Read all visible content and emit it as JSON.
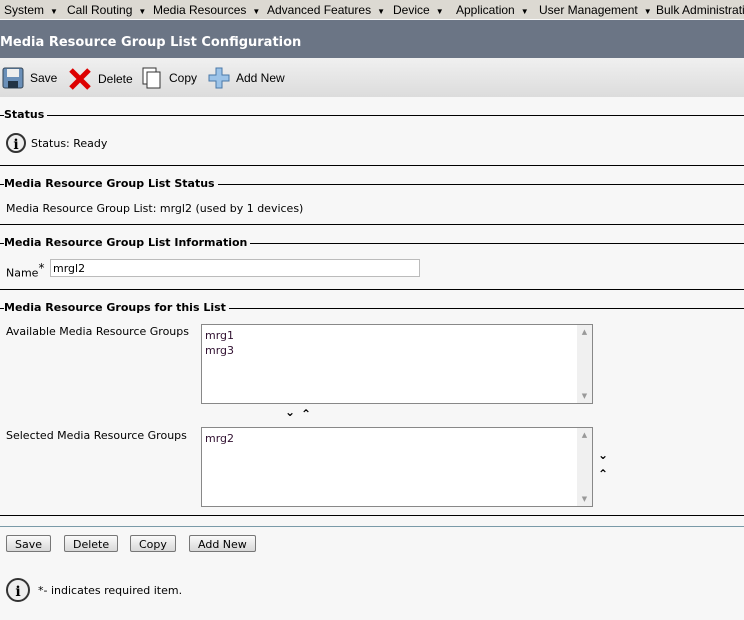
{
  "menu": [
    "System",
    "Call Routing",
    "Media Resources",
    "Advanced Features",
    "Device",
    "Application",
    "User Management",
    "Bulk Administration"
  ],
  "title": "Media Resource Group List Configuration",
  "toolbar": {
    "save": "Save",
    "delete": "Delete",
    "copy": "Copy",
    "add_new": "Add New"
  },
  "status": {
    "legend": "Status",
    "text": "Status: Ready"
  },
  "list_status": {
    "legend": "Media Resource Group List Status",
    "text": "Media Resource Group List: mrgl2 (used by 1 devices)"
  },
  "info": {
    "legend": "Media Resource Group List Information",
    "name_label": "Name",
    "required_mark": "*",
    "name_value": "mrgl2"
  },
  "groups": {
    "legend": "Media Resource Groups for this List",
    "available_label": "Available Media Resource Groups",
    "available": [
      "mrg1",
      "mrg3"
    ],
    "selected_label": "Selected Media Resource Groups",
    "selected": [
      "mrg2"
    ]
  },
  "buttons": {
    "save": "Save",
    "delete": "Delete",
    "copy": "Copy",
    "add_new": "Add New"
  },
  "footer_note": "*- indicates required item."
}
